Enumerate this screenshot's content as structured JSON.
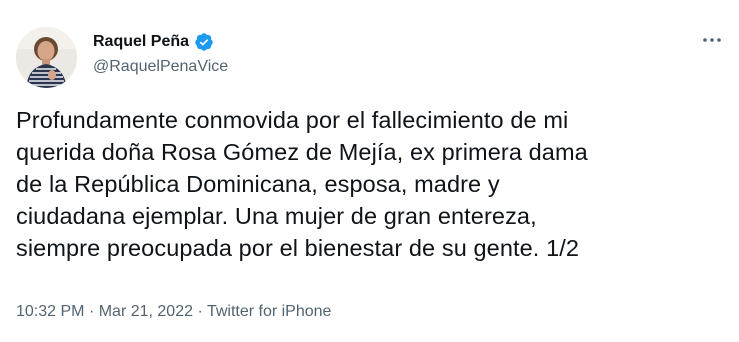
{
  "author": {
    "display_name": "Raquel Peña",
    "handle": "@RaquelPenaVice",
    "verified": true,
    "verified_badge_color": "#1d9bf0",
    "avatar_icon": "profile-photo"
  },
  "more_icon": "more-horizontal-icon",
  "tweet": {
    "text": "Profundamente conmovida por el fallecimiento de mi\nquerida doña Rosa Gómez de Mejía, ex primera dama\nde la República Dominicana, esposa, madre y\nciudadana ejemplar. Una mujer de gran entereza,\nsiempre preocupada por el bienestar de su gente. 1/2",
    "time": "10:32 PM",
    "date": "Mar 21, 2022",
    "source": "Twitter for iPhone",
    "separator": "·"
  },
  "colors": {
    "text_primary": "#0f1419",
    "text_secondary": "#536471",
    "background": "#ffffff"
  }
}
